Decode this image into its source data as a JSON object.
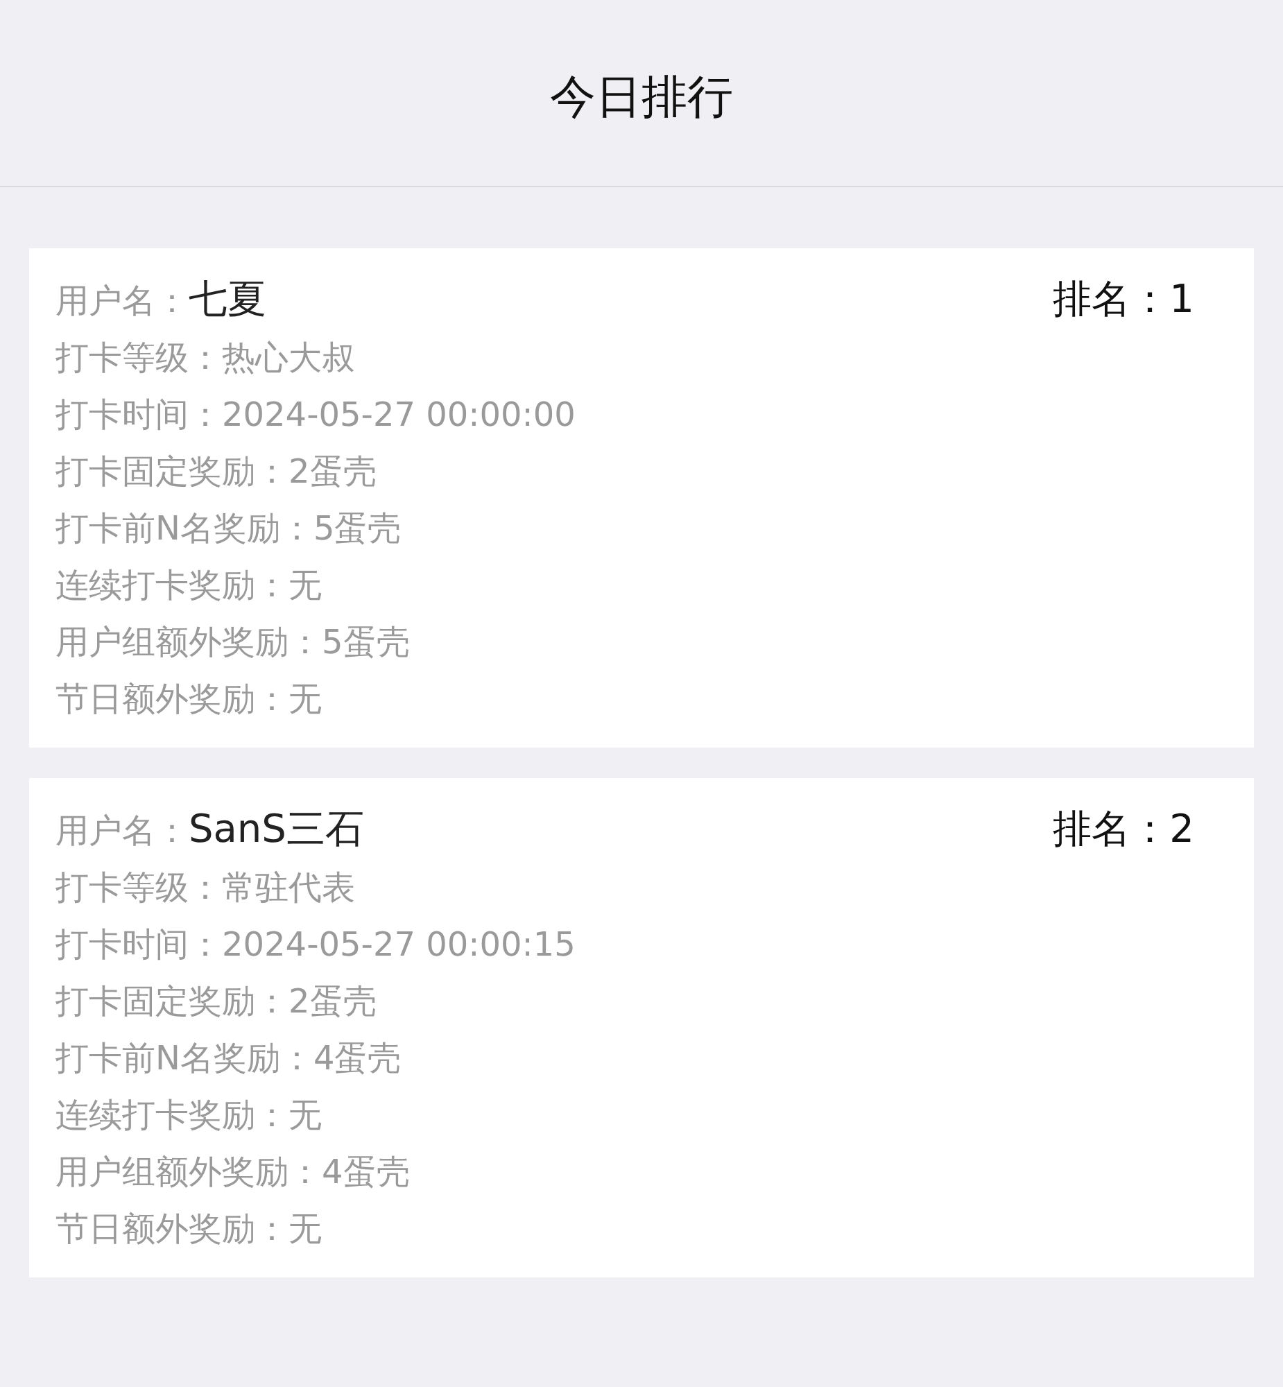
{
  "header": {
    "title": "今日排行"
  },
  "cards": [
    {
      "username_label": "用户名：",
      "username": "七夏",
      "rank": "排名：1",
      "details": [
        "打卡等级：热心大叔",
        "打卡时间：2024-05-27 00:00:00",
        "打卡固定奖励：2蛋壳",
        "打卡前N名奖励：5蛋壳",
        "连续打卡奖励：无",
        "用户组额外奖励：5蛋壳",
        "节日额外奖励：无"
      ]
    },
    {
      "username_label": "用户名：",
      "username": "SanS三石",
      "rank": "排名：2",
      "details": [
        "打卡等级：常驻代表",
        "打卡时间：2024-05-27 00:00:15",
        "打卡固定奖励：2蛋壳",
        "打卡前N名奖励：4蛋壳",
        "连续打卡奖励：无",
        "用户组额外奖励：4蛋壳",
        "节日额外奖励：无"
      ]
    }
  ]
}
